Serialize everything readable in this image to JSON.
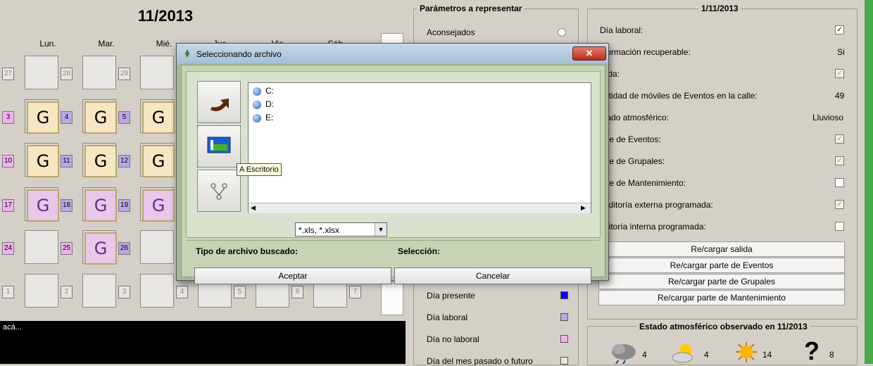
{
  "calendar": {
    "title": "11/2013",
    "days_of_week": [
      "Lun.",
      "Mar.",
      "Mié.",
      "Jue.",
      "Vie.",
      "Sáb."
    ],
    "row_numbers": [
      [
        "27",
        "28",
        "29"
      ],
      [
        "3",
        "4",
        "5"
      ],
      [
        "10",
        "11",
        "12"
      ],
      [
        "17",
        "18",
        "19"
      ],
      [
        "24",
        "25",
        "26"
      ],
      [
        "1",
        "2",
        "3",
        "4",
        "5",
        "6",
        "7"
      ]
    ],
    "g_letter": "G"
  },
  "console": {
    "text": "acá..."
  },
  "params": {
    "title": "Parámetros a representar",
    "aconsejados": "Aconsejados",
    "legend": [
      {
        "label": "Día presente",
        "color": "#0000ff"
      },
      {
        "label": "Día laboral",
        "color": "#b8a8e8"
      },
      {
        "label": "Día no laboral",
        "color": "#f3b0f0"
      },
      {
        "label": "Día del mes pasado o futuro",
        "color": "#e8e6e2"
      }
    ]
  },
  "day_info": {
    "title": "1/11/2013",
    "rows": [
      {
        "label": "Día laboral:",
        "value": ""
      },
      {
        "label": "formación recuperable:",
        "value": "Si"
      },
      {
        "label": "lida:",
        "value": ""
      },
      {
        "label": "ntidad de móviles de Eventos en la calle:",
        "value": "49"
      },
      {
        "label": "tado atmosférico:",
        "value": "Lluvioso"
      },
      {
        "label": "rte de Eventos:",
        "value": ""
      },
      {
        "label": "rte de Grupales:",
        "value": ""
      },
      {
        "label": "rte de Mantenimiento:",
        "value": ""
      },
      {
        "label": "uditoría externa programada:",
        "value": ""
      },
      {
        "label": "ditoría interna programada:",
        "value": ""
      }
    ],
    "buttons": [
      "Re/cargar salida",
      "Re/cargar parte de Eventos",
      "Re/cargar parte de Grupales",
      "Re/cargar parte de Mantenimiento"
    ]
  },
  "weather": {
    "title": "Estado atmosférico observado en 11/2013",
    "counts": [
      "4",
      "4",
      "14",
      "8"
    ],
    "question_mark": "?"
  },
  "dialog": {
    "title": "Seleccionando archivo",
    "close_symbol": "✕",
    "drives": [
      "C:",
      "D:",
      "E:"
    ],
    "tooltip": "A Escritorio",
    "filetype_label": "Tipo de archivo buscado:",
    "filetype_value": "*.xls, *.xlsx",
    "selection_label": "Selección:",
    "accept": "Aceptar",
    "cancel": "Cancelar"
  }
}
